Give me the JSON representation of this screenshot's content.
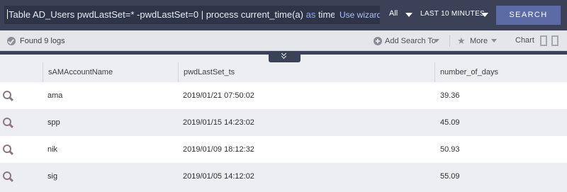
{
  "toolbar": {
    "query_prefix": "Table AD_Users pwdLastSet=* -pwdLastSet=0 | process current_time(a) ",
    "query_keyword": "as",
    "query_suffix": " time",
    "wizard_label": "Use wizard",
    "range_all": "All",
    "range_time": "LAST 10 MINUTES",
    "search_label": "SEARCH"
  },
  "subbar": {
    "found_text": "Found 9 logs",
    "add_search_label": "Add Search To",
    "more_label": "More",
    "chart_label": "Chart"
  },
  "table": {
    "columns": [
      "sAMAccountName",
      "pwdLastSet_ts",
      "number_of_days"
    ],
    "rows": [
      {
        "name": "ama",
        "ts": "2019/01/21 07:50:02",
        "days": "39.36"
      },
      {
        "name": "spp",
        "ts": "2019/01/15 14:23:02",
        "days": "45.09"
      },
      {
        "name": "nik",
        "ts": "2019/01/09 18:12:32",
        "days": "50.93"
      },
      {
        "name": "sig",
        "ts": "2019/01/05 14:12:02",
        "days": "55.09"
      }
    ]
  },
  "icons": {
    "found": "check-circle-icon",
    "add_search": "plus-circle-icon",
    "more": "star-icon",
    "row_action": "magnifier-icon",
    "collapse": "double-chevron-down-icon"
  },
  "colors": {
    "topbar": "#3b4257",
    "search_button": "#5c6ba5",
    "link": "#aebff5",
    "row_icon": "#8f7786"
  }
}
